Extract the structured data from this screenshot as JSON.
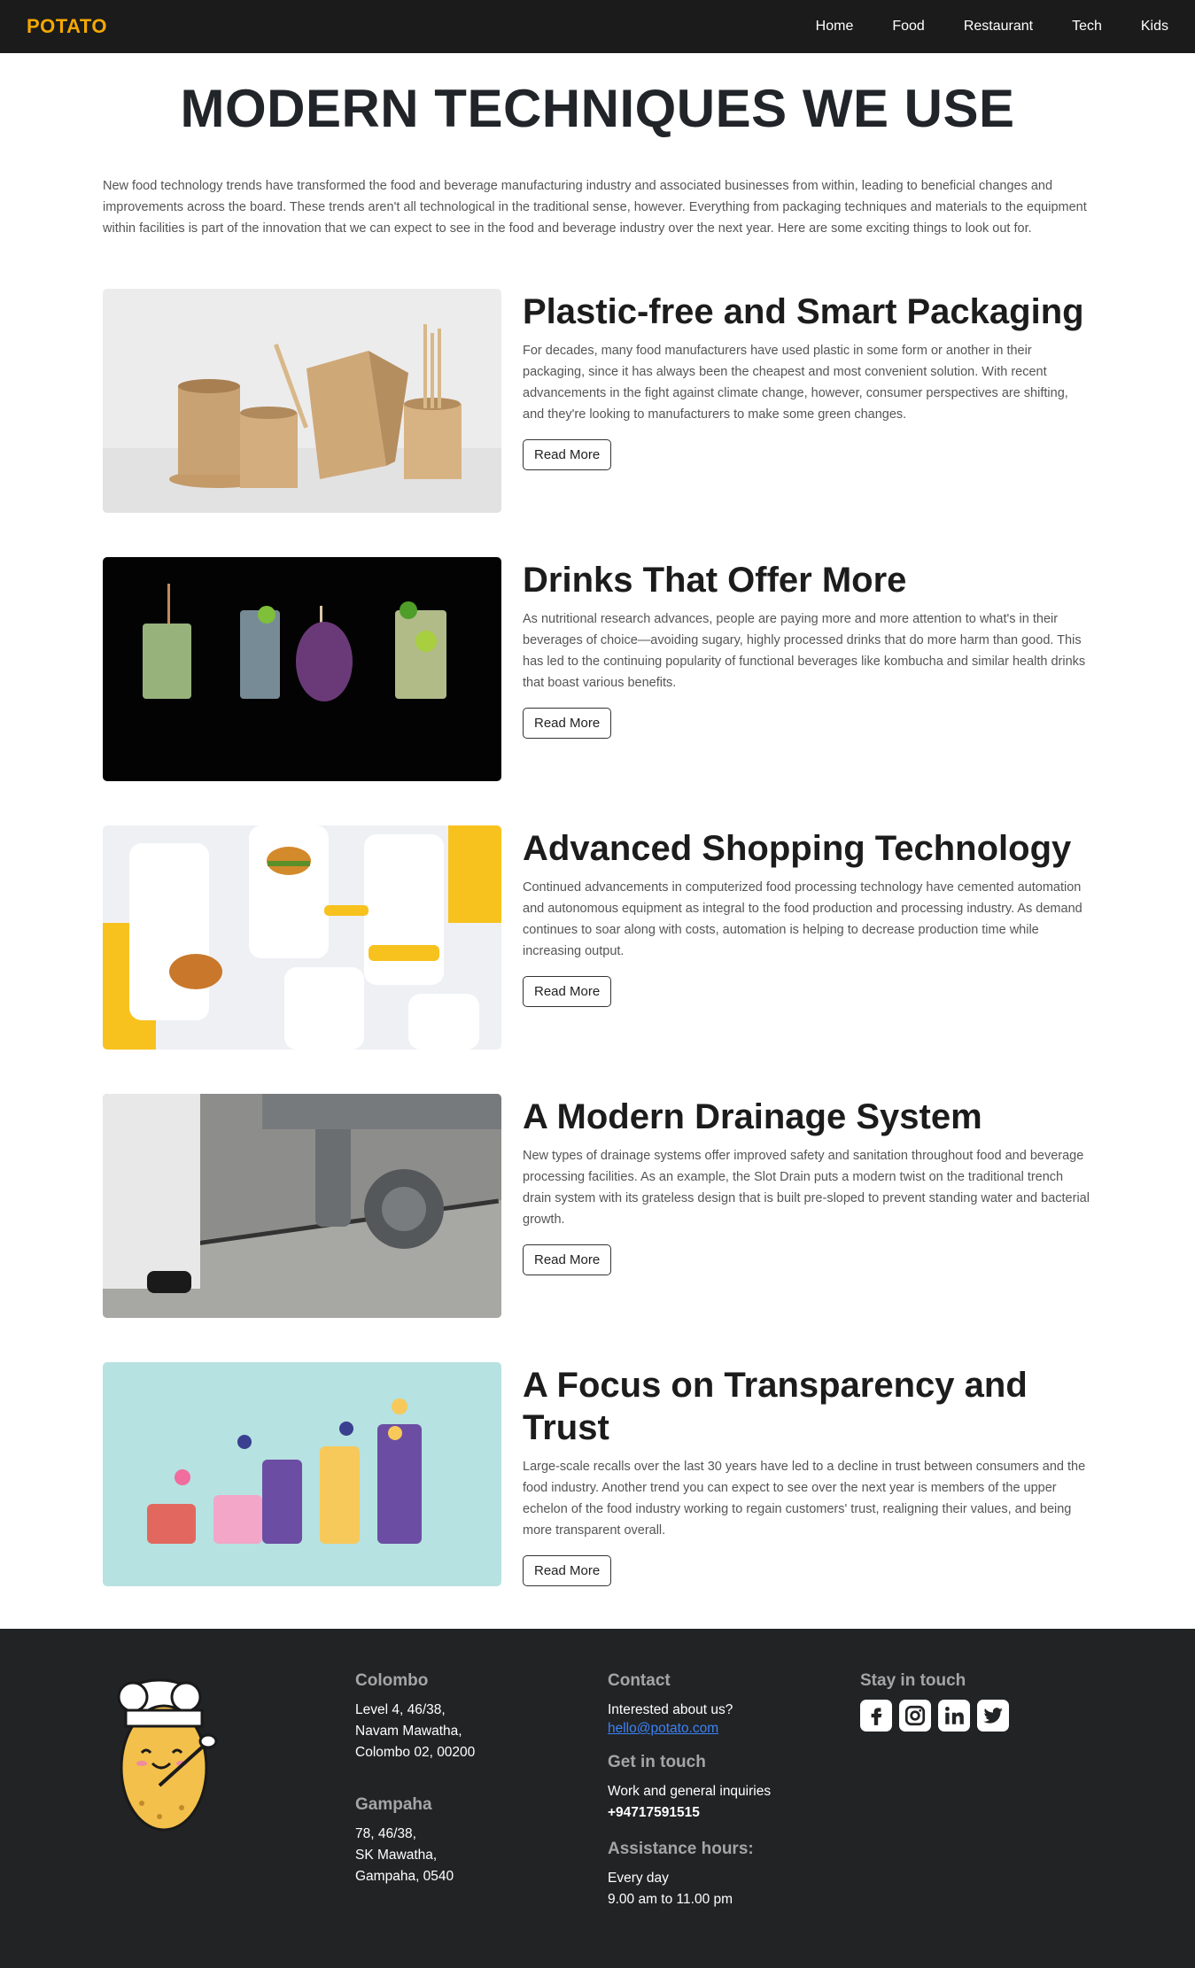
{
  "nav": {
    "brand": "POTATO",
    "links": [
      "Home",
      "Food",
      "Restaurant",
      "Tech",
      "Kids"
    ]
  },
  "page": {
    "title": "MODERN TECHNIQUES WE USE",
    "intro": "New food technology trends have transformed the food and beverage manufacturing industry and associated businesses from within, leading to beneficial changes and improvements across the board. These trends aren't all technological in the traditional sense, however. Everything from packaging techniques and materials to the equipment within facilities is part of the innovation that we can expect to see in the food and beverage industry over the next year. Here are some exciting things to look out for."
  },
  "articles": [
    {
      "title": "Plastic-free and Smart Packaging",
      "text": "For decades, many food manufacturers have used plastic in some form or another in their packaging, since it has always been the cheapest and most convenient solution. With recent advancements in the fight against climate change, however, consumer perspectives are shifting, and they're looking to manufacturers to make some green changes.",
      "button": "Read More"
    },
    {
      "title": "Drinks That Offer More",
      "text": "As nutritional research advances, people are paying more and more attention to what's in their beverages of choice—avoiding sugary, highly processed drinks that do more harm than good. This has led to the continuing popularity of functional beverages like kombucha and similar health drinks that boast various benefits.",
      "button": "Read More"
    },
    {
      "title": "Advanced Shopping Technology",
      "text": "Continued advancements in computerized food processing technology have cemented automation and autonomous equipment as integral to the food production and processing industry. As demand continues to soar along with costs, automation is helping to decrease production time while increasing output.",
      "button": "Read More"
    },
    {
      "title": "A Modern Drainage System",
      "text": "New types of drainage systems offer improved safety and sanitation throughout food and beverage processing facilities. As an example, the Slot Drain puts a modern twist on the traditional trench drain system with its grateless design that is built pre-sloped to prevent standing water and bacterial growth.",
      "button": "Read More"
    },
    {
      "title": "A Focus on Transparency and Trust",
      "text": "Large-scale recalls over the last 30 years have led to a decline in trust between consumers and the food industry. Another trend you can expect to see over the next year is members of the upper echelon of the food industry working to regain customers' trust, realigning their values, and being more transparent overall.",
      "button": "Read More"
    }
  ],
  "footer": {
    "colombo": {
      "heading": "Colombo",
      "lines": [
        "Level 4, 46/38,",
        "Navam Mawatha,",
        "Colombo 02, 00200"
      ]
    },
    "gampaha": {
      "heading": "Gampaha",
      "lines": [
        "78, 46/38,",
        "SK Mawatha,",
        "Gampaha, 0540"
      ]
    },
    "contact": {
      "heading": "Contact",
      "text": "Interested about us?",
      "email": "hello@potato.com"
    },
    "get_in_touch": {
      "heading": "Get in touch",
      "text": "Work and general inquiries",
      "phone": "+94717591515"
    },
    "hours": {
      "heading": "Assistance hours:",
      "days": "Every day",
      "time": "9.00 am to 11.00 pm"
    },
    "social": {
      "heading": "Stay in touch",
      "icons": [
        "facebook-icon",
        "instagram-icon",
        "linkedin-icon",
        "twitter-icon"
      ]
    }
  },
  "colors": {
    "brand": "#f5a800",
    "nav_bg": "#1b1b1c",
    "footer_bg": "#222325",
    "link": "#3b82f6"
  }
}
